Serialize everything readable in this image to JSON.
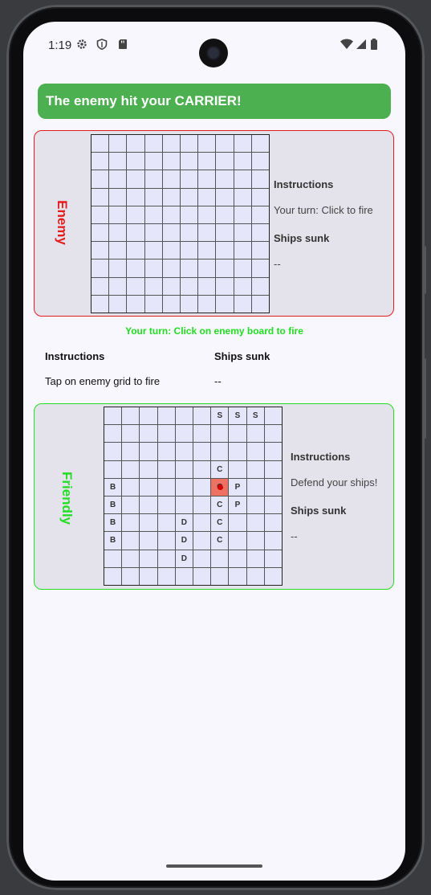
{
  "status_bar": {
    "time": "1:19",
    "left_icons": [
      "gear-icon",
      "shield-icon",
      "sd-card-icon"
    ],
    "right_icons": [
      "wifi-icon",
      "signal-icon",
      "battery-icon"
    ]
  },
  "banner": {
    "text": "The enemy hit your CARRIER!",
    "color": "#4caf50"
  },
  "enemy_board": {
    "label": "Enemy",
    "label_color": "#e51c1c",
    "instructions_header": "Instructions",
    "instructions_text": "Your turn: Click to fire",
    "ships_sunk_header": "Ships sunk",
    "ships_sunk_value": "--",
    "rows": [
      [
        "",
        "",
        "",
        "",
        "",
        "",
        "",
        "",
        "",
        ""
      ],
      [
        "",
        "",
        "",
        "",
        "",
        "",
        "",
        "",
        "",
        ""
      ],
      [
        "",
        "",
        "",
        "",
        "",
        "",
        "",
        "",
        "",
        ""
      ],
      [
        "",
        "",
        "",
        "",
        "",
        "",
        "",
        "",
        "",
        ""
      ],
      [
        "",
        "",
        "",
        "",
        "",
        "",
        "",
        "",
        "",
        ""
      ],
      [
        "",
        "",
        "",
        "",
        "",
        "",
        "",
        "",
        "",
        ""
      ],
      [
        "",
        "",
        "",
        "",
        "",
        "",
        "",
        "",
        "",
        ""
      ],
      [
        "",
        "",
        "",
        "",
        "",
        "",
        "",
        "",
        "",
        ""
      ],
      [
        "",
        "",
        "",
        "",
        "",
        "",
        "",
        "",
        "",
        ""
      ],
      [
        "",
        "",
        "",
        "",
        "",
        "",
        "",
        "",
        "",
        ""
      ]
    ]
  },
  "turn_message": "Your turn: Click on enemy board to fire",
  "summary": {
    "instructions_header": "Instructions",
    "instructions_text": "Tap on enemy grid to fire",
    "ships_sunk_header": "Ships sunk",
    "ships_sunk_value": "--"
  },
  "friendly_board": {
    "label": "Friendly",
    "label_color": "#22dd22",
    "instructions_header": "Instructions",
    "instructions_text": "Defend your ships!",
    "ships_sunk_header": "Ships sunk",
    "ships_sunk_value": "--",
    "hit_cell": {
      "row": 4,
      "col": 6
    },
    "rows": [
      [
        "",
        "",
        "",
        "",
        "",
        "",
        "S",
        "S",
        "S",
        ""
      ],
      [
        "",
        "",
        "",
        "",
        "",
        "",
        "",
        "",
        "",
        ""
      ],
      [
        "",
        "",
        "",
        "",
        "",
        "",
        "",
        "",
        "",
        ""
      ],
      [
        "",
        "",
        "",
        "",
        "",
        "",
        "C",
        "",
        "",
        ""
      ],
      [
        "B",
        "",
        "",
        "",
        "",
        "",
        "C",
        "P",
        "",
        ""
      ],
      [
        "B",
        "",
        "",
        "",
        "",
        "",
        "C",
        "P",
        "",
        ""
      ],
      [
        "B",
        "",
        "",
        "",
        "D",
        "",
        "C",
        "",
        "",
        ""
      ],
      [
        "B",
        "",
        "",
        "",
        "D",
        "",
        "C",
        "",
        "",
        ""
      ],
      [
        "",
        "",
        "",
        "",
        "D",
        "",
        "",
        "",
        "",
        ""
      ],
      [
        "",
        "",
        "",
        "",
        "",
        "",
        "",
        "",
        "",
        ""
      ]
    ]
  }
}
